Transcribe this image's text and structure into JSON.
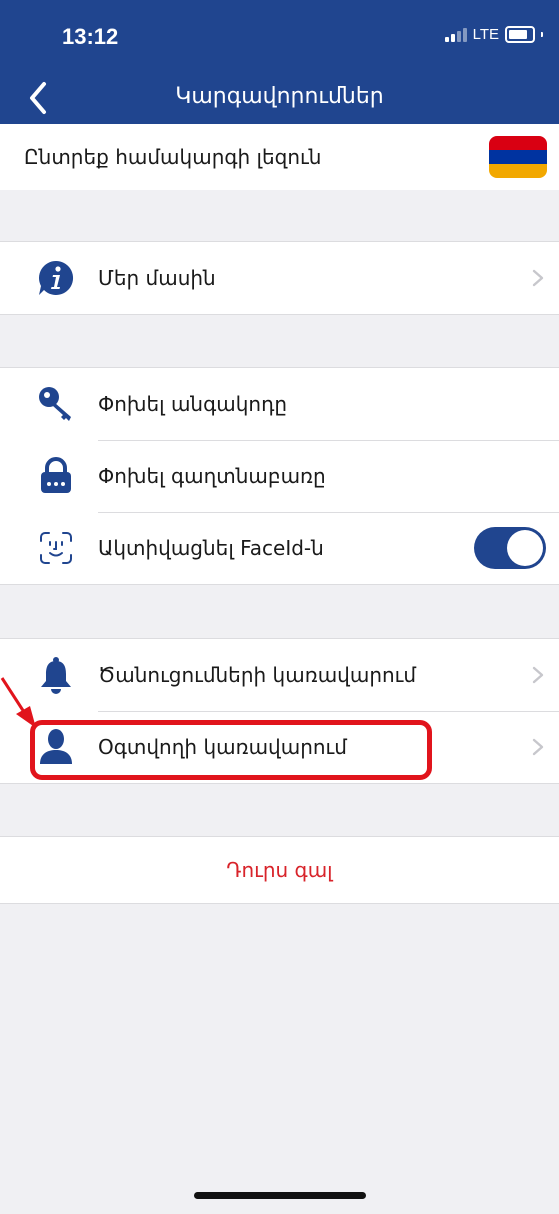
{
  "status_bar": {
    "time": "13:12",
    "network": "LTE"
  },
  "nav": {
    "title": "Կարգավորումներ"
  },
  "language_row": {
    "label": "Ընտրեք համակարգի լեզուն",
    "flag_colors": [
      "#d90012",
      "#0033a0",
      "#f2a800"
    ]
  },
  "about_row": {
    "label": "Մեր մասին",
    "icon": "info-icon"
  },
  "security": {
    "change_password": {
      "label": "Փոխել անգակոդը",
      "icon": "key-icon"
    },
    "change_passcode": {
      "label": "Փոխել գաղտնաբառը",
      "icon": "lock-icon"
    },
    "faceid": {
      "label": "Ակտիվացնել FaceId-ն",
      "icon": "faceid-icon",
      "enabled": true
    }
  },
  "management": {
    "notifications": {
      "label": "Ծանուցումների կառավարում",
      "icon": "bell-icon"
    },
    "user": {
      "label": "Օգտվողի կառավարում",
      "icon": "user-icon"
    }
  },
  "logout": {
    "label": "Դուրս գալ"
  },
  "colors": {
    "primary": "#20458f",
    "danger": "#d8232a",
    "highlight": "#e1141c",
    "background": "#f0f0f3"
  }
}
